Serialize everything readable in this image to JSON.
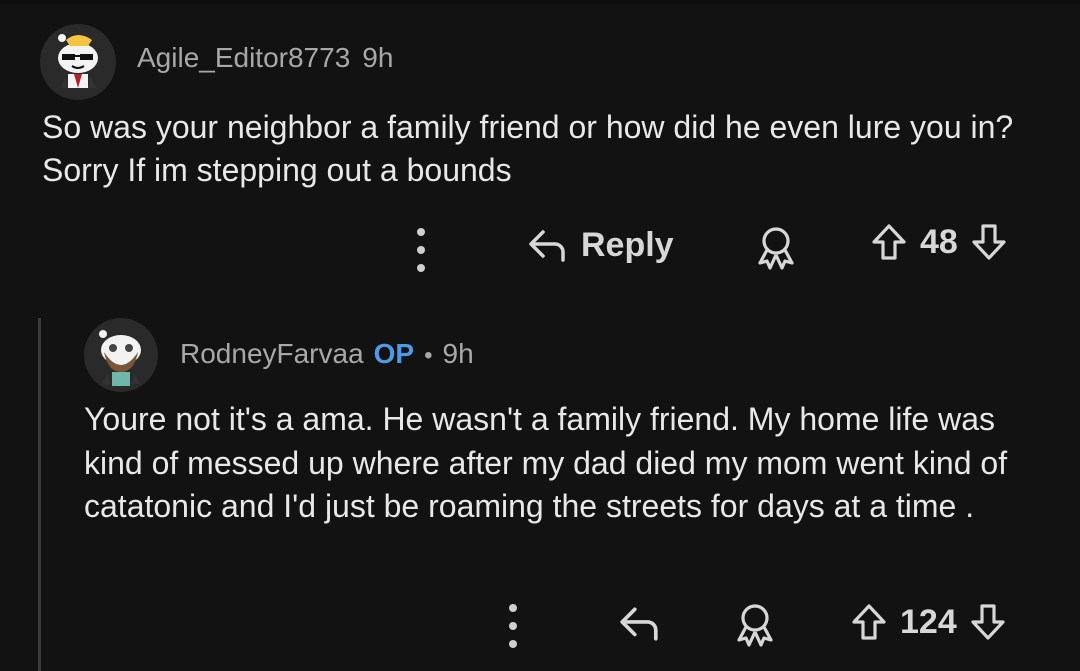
{
  "comments": [
    {
      "username": "Agile_Editor8773",
      "time": "9h",
      "body": "So was your neighbor a family friend or how did he even lure you in? Sorry If im stepping out a bounds",
      "reply_label": "Reply",
      "score": "48",
      "avatar_icon": "snoo-sunglasses-avatar-icon"
    },
    {
      "username": "RodneyFarvaa",
      "op_badge": "OP",
      "separator": "•",
      "time": "9h",
      "body": "Youre not it's a ama. He wasn't a family friend. My home life was kind of messed up where after my dad died my mom went kind of catatonic and I'd just be roaming the streets for days at a time .",
      "score": "124",
      "avatar_icon": "snoo-bearded-avatar-icon"
    }
  ],
  "colors": {
    "background": "#121212",
    "text": "#e8e8e8",
    "meta": "#a8a8a8",
    "op": "#4c9be8"
  }
}
